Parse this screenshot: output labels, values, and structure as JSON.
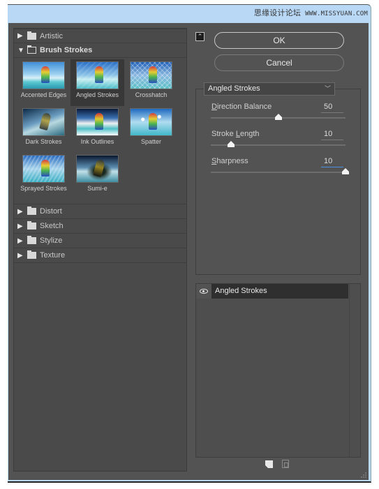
{
  "watermark": {
    "text": "思缘设计论坛",
    "url": "WWW.MISSYUAN.COM"
  },
  "filter_gallery": {
    "categories_before": [
      {
        "label": "Artistic",
        "expanded": false
      }
    ],
    "expanded_category": {
      "label": "Brush Strokes",
      "filters": [
        {
          "label": "Accented Edges",
          "selected": false,
          "style": "accented"
        },
        {
          "label": "Angled Strokes",
          "selected": true,
          "style": "angled"
        },
        {
          "label": "Crosshatch",
          "selected": false,
          "style": "crosshatch"
        },
        {
          "label": "Dark Strokes",
          "selected": false,
          "style": "dark"
        },
        {
          "label": "Ink Outlines",
          "selected": false,
          "style": "ink"
        },
        {
          "label": "Spatter",
          "selected": false,
          "style": "spatter"
        },
        {
          "label": "Sprayed Strokes",
          "selected": false,
          "style": "sprayed"
        },
        {
          "label": "Sumi-e",
          "selected": false,
          "style": "sumie"
        }
      ]
    },
    "categories_after": [
      {
        "label": "Distort",
        "expanded": false
      },
      {
        "label": "Sketch",
        "expanded": false
      },
      {
        "label": "Stylize",
        "expanded": false
      },
      {
        "label": "Texture",
        "expanded": false
      }
    ]
  },
  "buttons": {
    "ok": "OK",
    "cancel": "Cancel",
    "collapse_icon": "double-chevron-up-icon"
  },
  "settings": {
    "selected_filter": "Angled Strokes",
    "params": [
      {
        "label": "Direction Balance",
        "mnemonic": "D",
        "value": "50",
        "min": 0,
        "max": 100,
        "fraction": 0.5,
        "active": false
      },
      {
        "label": "Stroke Length",
        "mnemonic": "L",
        "value": "10",
        "min": 3,
        "max": 50,
        "fraction": 0.15,
        "active": false
      },
      {
        "label": "Sharpness",
        "mnemonic": "S",
        "value": "10",
        "min": 0,
        "max": 10,
        "fraction": 1.0,
        "active": true
      }
    ]
  },
  "layers": {
    "items": [
      {
        "name": "Angled Strokes",
        "visible": true
      }
    ]
  },
  "colors": {
    "dialog_bg": "#535353",
    "panel_bg": "#4a4a4a",
    "selected_layer_bg": "#2f2f2f",
    "active_field_underline": "#4a8fe0",
    "window_chrome": "#b9d8f5"
  }
}
